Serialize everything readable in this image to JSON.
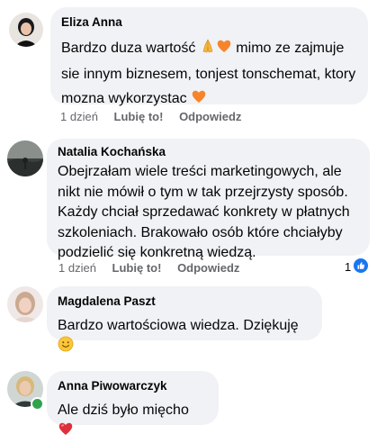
{
  "comments": [
    {
      "author": "Eliza Anna",
      "text_part1": "Bardzo duza wartość ",
      "text_part2": " mimo ze zajmuje sie innym biznesem, tonjest tonschemat, ktory mozna wykorzystac ",
      "time": "1 dzień",
      "like_label": "Lubię to!",
      "reply_label": "Odpowiedz",
      "emoji_icons": [
        "folded-hands-icon",
        "orange-heart-icon",
        "orange-heart-icon"
      ]
    },
    {
      "author": "Natalia Kochańska",
      "text": "Obejrzałam wiele treści marketingowych, ale nikt nie mówił o tym w tak przejrzysty sposób. Każdy chciał sprzedawać konkrety w płatnych szkoleniach. Brakowało osób które chciałyby podzielić się konkretną wiedzą.",
      "time": "1 dzień",
      "like_label": "Lubię to!",
      "reply_label": "Odpowiedz",
      "reaction_count": "1",
      "reaction_icon": "like-reaction-icon"
    },
    {
      "author": "Magdalena Paszt",
      "text": "Bardzo wartościowa wiedza. Dziękuję ",
      "emoji_icons": [
        "smiling-face-icon"
      ]
    },
    {
      "author": "Anna Piwowarczyk",
      "text": "Ale dziś było mięcho ",
      "emoji_icons": [
        "red-heart-icon"
      ],
      "online": true
    }
  ],
  "colors": {
    "bubble": "#f0f2f5",
    "meta_text": "#65676b",
    "like_blue": "#1877f2",
    "online_green": "#31a24c"
  }
}
